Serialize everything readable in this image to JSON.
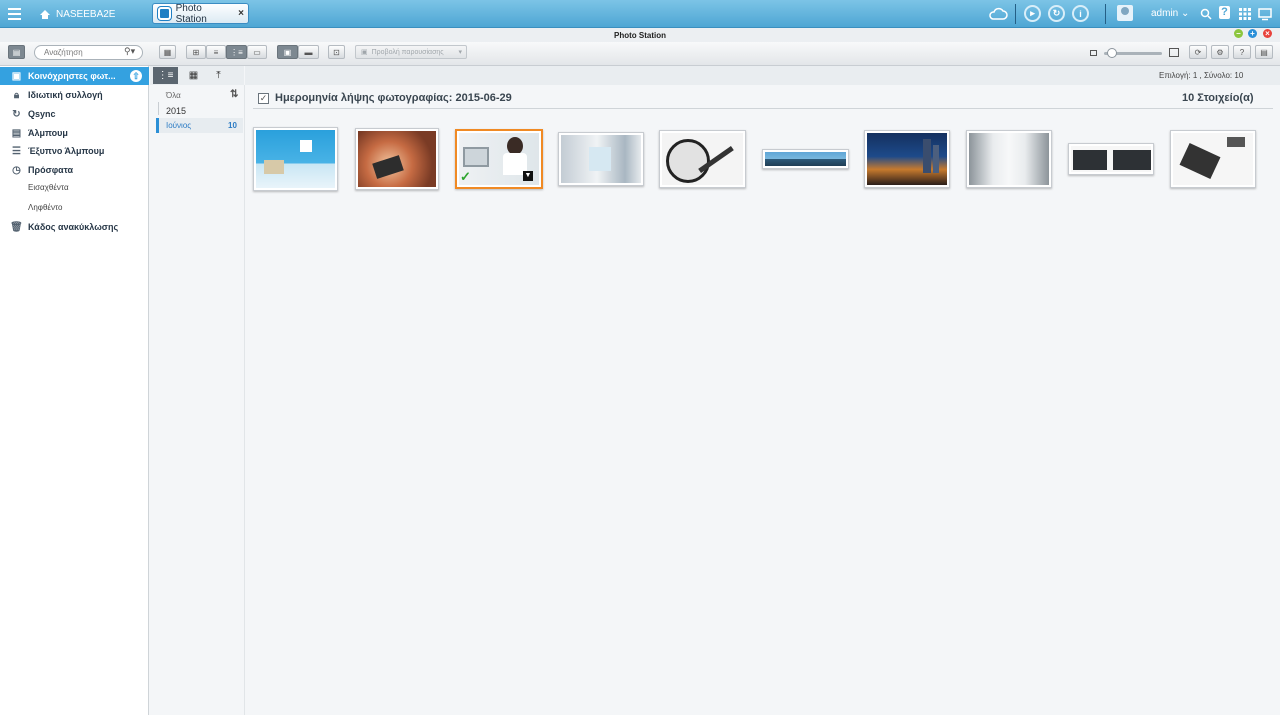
{
  "topbar": {
    "nas_name": "NASEEBA2E",
    "app_tab": "Photo Station",
    "tab_close": "×",
    "user": "admin",
    "user_caret": "⌄",
    "help_glyph": "?",
    "info_glyph": "i"
  },
  "window": {
    "title": "Photo Station",
    "minimize": "–",
    "maximize": "+",
    "close": "×"
  },
  "toolbar": {
    "search_placeholder": "Αναζήτηση",
    "slideshow_label": "Προβολή παρουσίασης",
    "help_glyph": "?"
  },
  "sidebar": {
    "items": [
      {
        "label": "Κοινόχρηστες φωτ...",
        "icon": "photo-icon"
      },
      {
        "label": "Ιδιωτική συλλογή",
        "icon": "lock-icon"
      },
      {
        "label": "Qsync",
        "icon": "sync-icon"
      },
      {
        "label": "Άλμπουμ",
        "icon": "album-icon"
      },
      {
        "label": "Έξυπνο Άλμπουμ",
        "icon": "smart-album-icon"
      },
      {
        "label": "Πρόσφατα",
        "icon": "clock-icon"
      },
      {
        "label": "Εισαχθέντα"
      },
      {
        "label": "Ληφθέντο"
      },
      {
        "label": "Κάδος ανακύκλωσης",
        "icon": "trash-icon"
      }
    ]
  },
  "timeline": {
    "all_label": "Όλα",
    "year": "2015",
    "month": "Ιούνιος",
    "month_count": "10"
  },
  "main": {
    "selection_text": "Επιλογή: 1 , Σύνολο: 10",
    "date_title": "Ημερομηνία λήψης φωτογραφίας: 2015-06-29",
    "items_count": "10 Στοιχείο(α)",
    "check_glyph": "✓",
    "photos": [
      {
        "name": "blue-room"
      },
      {
        "name": "tablet-hands"
      },
      {
        "name": "woman-at-computer",
        "selected": true
      },
      {
        "name": "office-interior"
      },
      {
        "name": "hard-drive"
      },
      {
        "name": "city-panorama"
      },
      {
        "name": "city-night"
      },
      {
        "name": "server-room"
      },
      {
        "name": "nas-devices"
      },
      {
        "name": "desk-items"
      }
    ]
  },
  "colors": {
    "accent": "#34a1e0",
    "selected_border": "#f08a24",
    "topbar": "#4ea6d4"
  }
}
